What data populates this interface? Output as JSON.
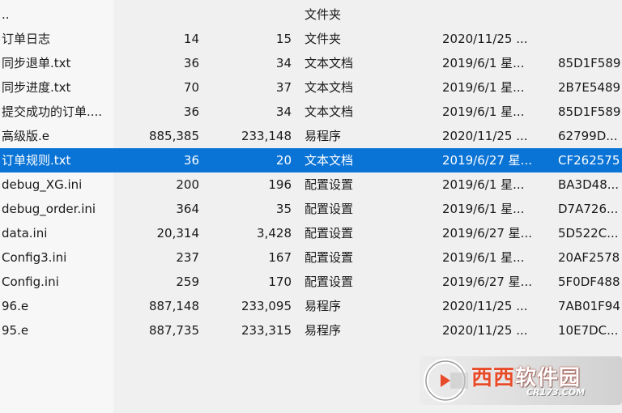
{
  "file_list": {
    "rows": [
      {
        "name": "..",
        "size": "",
        "packed": "",
        "type": "文件夹",
        "modified": "",
        "crc": ""
      },
      {
        "name": "订单日志",
        "size": "14",
        "packed": "15",
        "type": "文件夹",
        "modified": "2020/11/25 ...",
        "crc": ""
      },
      {
        "name": "同步退单.txt",
        "size": "36",
        "packed": "34",
        "type": "文本文档",
        "modified": "2019/6/1 星...",
        "crc": "85D1F589"
      },
      {
        "name": "同步进度.txt",
        "size": "70",
        "packed": "37",
        "type": "文本文档",
        "modified": "2019/6/1 星...",
        "crc": "2B7E5489"
      },
      {
        "name": "提交成功的订单....",
        "size": "36",
        "packed": "34",
        "type": "文本文档",
        "modified": "2019/6/1 星...",
        "crc": "85D1F589"
      },
      {
        "name": "高级版.e",
        "size": "885,385",
        "packed": "233,148",
        "type": "易程序",
        "modified": "2020/11/25 ...",
        "crc": "62799D..."
      },
      {
        "name": "订单规则.txt",
        "size": "36",
        "packed": "20",
        "type": "文本文档",
        "modified": "2019/6/27 星...",
        "crc": "CF262575"
      },
      {
        "name": "debug_XG.ini",
        "size": "200",
        "packed": "196",
        "type": "配置设置",
        "modified": "2019/6/1 星...",
        "crc": "BA3D48..."
      },
      {
        "name": "debug_order.ini",
        "size": "364",
        "packed": "35",
        "type": "配置设置",
        "modified": "2019/6/1 星...",
        "crc": "D7A726..."
      },
      {
        "name": "data.ini",
        "size": "20,314",
        "packed": "3,428",
        "type": "配置设置",
        "modified": "2019/6/27 星...",
        "crc": "5D522C..."
      },
      {
        "name": "Config3.ini",
        "size": "237",
        "packed": "167",
        "type": "配置设置",
        "modified": "2019/6/1 星...",
        "crc": "20AF2578"
      },
      {
        "name": "Config.ini",
        "size": "259",
        "packed": "170",
        "type": "配置设置",
        "modified": "2019/6/27 星...",
        "crc": "5F0DF488"
      },
      {
        "name": "96.e",
        "size": "887,148",
        "packed": "233,095",
        "type": "易程序",
        "modified": "2020/11/25 ...",
        "crc": "7AB01F94"
      },
      {
        "name": "95.e",
        "size": "887,735",
        "packed": "233,315",
        "type": "易程序",
        "modified": "2020/11/25 ...",
        "crc": "10E7DC..."
      }
    ],
    "selected_index": 6
  },
  "watermark": {
    "brand_part1": "西西",
    "brand_part2": "软件园",
    "site": "CR173.COM"
  },
  "colors": {
    "selection": "#0a74d6",
    "watermark_red": "#e84b2a"
  }
}
